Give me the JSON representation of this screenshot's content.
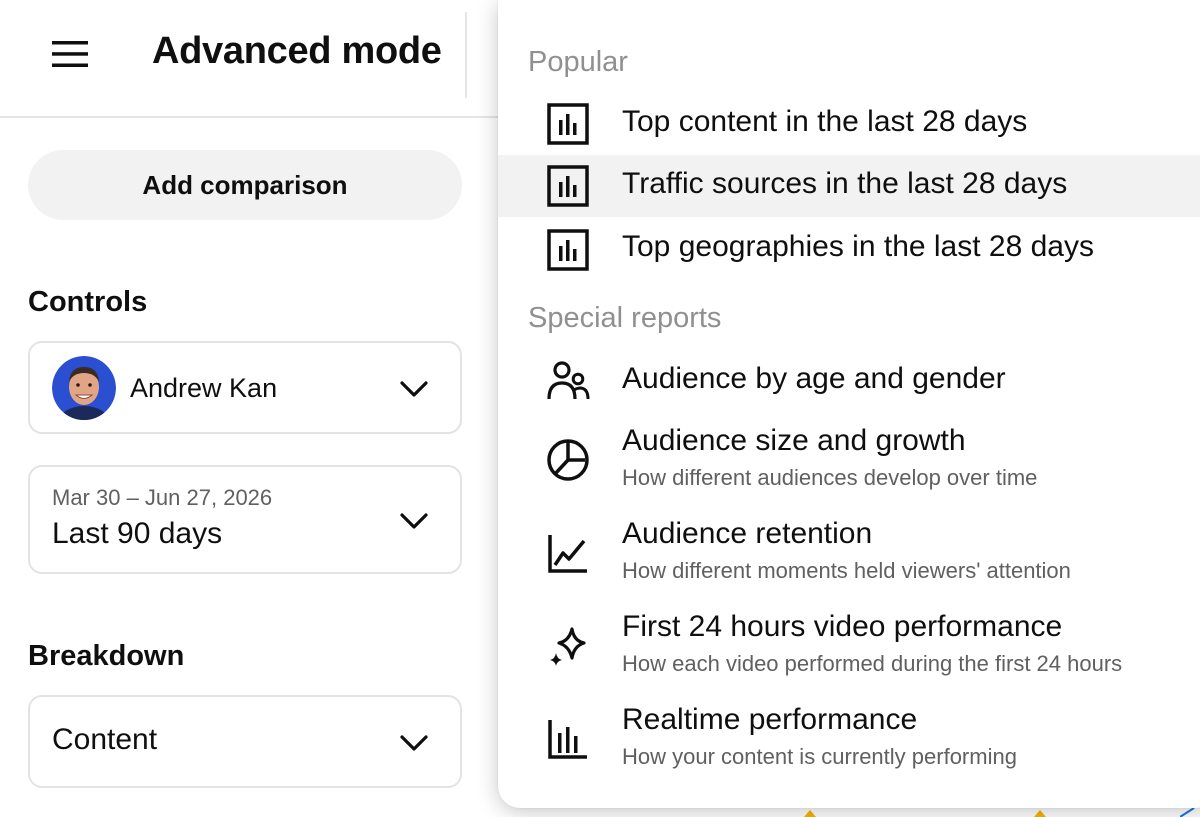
{
  "header": {
    "menu_icon": "hamburger-menu-icon",
    "title": "Advanced mode"
  },
  "add_comparison_label": "Add comparison",
  "controls": {
    "heading": "Controls",
    "channel": {
      "name": "Andrew Kan",
      "avatar_icon": "avatar-photo"
    },
    "date": {
      "range": "Mar 30 – Jun 27, 2026",
      "label": "Last 90 days"
    }
  },
  "breakdown": {
    "heading": "Breakdown",
    "value": "Content"
  },
  "menu": {
    "popular": {
      "heading": "Popular",
      "items": [
        {
          "title": "Top content in the last 28 days",
          "icon": "bar-chart-box-icon"
        },
        {
          "title": "Traffic sources in the last 28 days",
          "icon": "bar-chart-box-icon"
        },
        {
          "title": "Top geographies in the last 28 days",
          "icon": "bar-chart-box-icon"
        }
      ]
    },
    "special": {
      "heading": "Special reports",
      "items": [
        {
          "title": "Audience by age and gender",
          "subtitle": "",
          "icon": "people-icon"
        },
        {
          "title": "Audience size and growth",
          "subtitle": "How different audiences develop over time",
          "icon": "pie-chart-icon"
        },
        {
          "title": "Audience retention",
          "subtitle": "How different moments held viewers' attention",
          "icon": "line-chart-icon"
        },
        {
          "title": "First 24 hours video performance",
          "subtitle": "How each video performed during the first 24 hours",
          "icon": "sparkle-icon"
        },
        {
          "title": "Realtime performance",
          "subtitle": "How your content is currently performing",
          "icon": "bar-chart-icon"
        }
      ]
    }
  },
  "colors": {
    "text": "#0f0f0f",
    "secondary_text": "#606060",
    "section_heading": "#909090",
    "highlight_bg": "#f2f2f2",
    "button_bg": "#f2f2f2"
  }
}
